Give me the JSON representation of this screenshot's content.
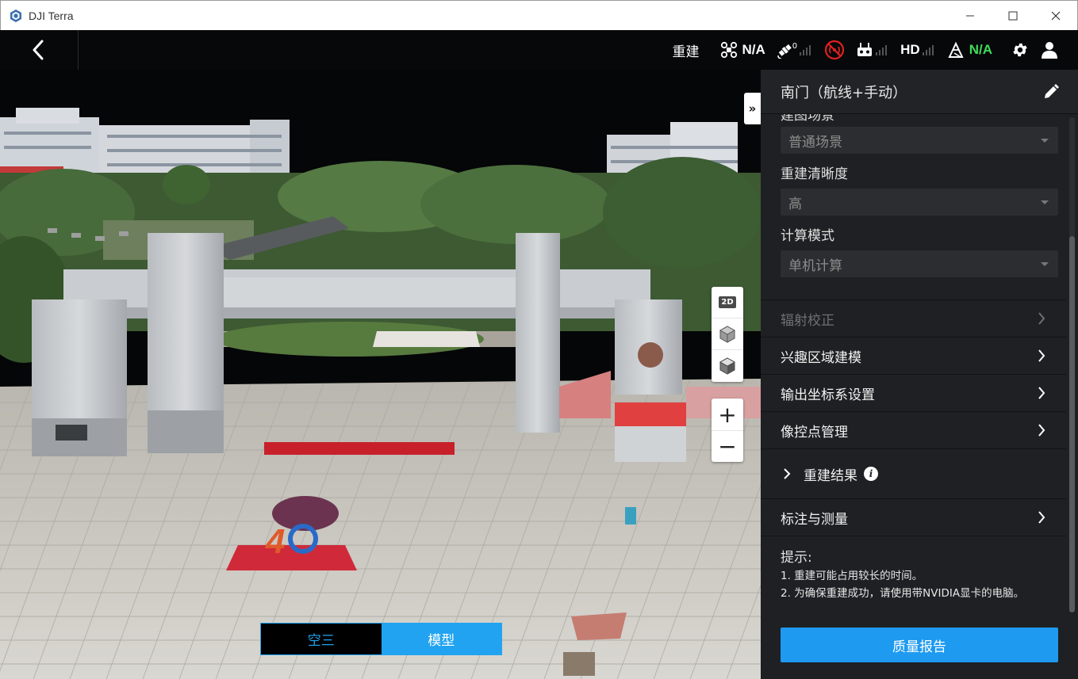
{
  "window": {
    "title": "DJI Terra",
    "minimize_label": "—",
    "maximize_label": "☐",
    "close_label": "✕"
  },
  "topbar": {
    "rebuild_label": "重建",
    "drone_status": "N/A",
    "gps_count": "0",
    "hd_label": "HD",
    "rtk_status": "N/A"
  },
  "scene": {
    "mode_tabs": [
      {
        "label": "空三",
        "active": false
      },
      {
        "label": "模型",
        "active": true
      }
    ],
    "view_2d_label": "2D",
    "zoom_in_label": "+",
    "zoom_out_label": "−",
    "collapse_label": "»"
  },
  "panel": {
    "title": "南门（航线+手动）",
    "fields": [
      {
        "label": "建图场景",
        "value": "普通场景"
      },
      {
        "label": "重建清晰度",
        "value": "高"
      },
      {
        "label": "计算模式",
        "value": "单机计算"
      }
    ],
    "menu": [
      {
        "label": "辐射校正",
        "disabled": true
      },
      {
        "label": "兴趣区域建模",
        "disabled": false
      },
      {
        "label": "输出坐标系设置",
        "disabled": false
      },
      {
        "label": "像控点管理",
        "disabled": false
      }
    ],
    "result_label": "重建结果",
    "info_label": "i",
    "annotate_label": "标注与测量",
    "tips_title": "提示:",
    "tips": [
      "1. 重建可能占用较长的时间。",
      "2. 为确保重建成功，请使用带NVIDIA显卡的电脑。"
    ],
    "report_button": "质量报告"
  },
  "colors": {
    "accent": "#1e9af0",
    "panel_bg": "#1f2023",
    "toolbar_bg": "#07080a",
    "status_green": "#3ddc5a",
    "signal_red": "#e02020"
  }
}
